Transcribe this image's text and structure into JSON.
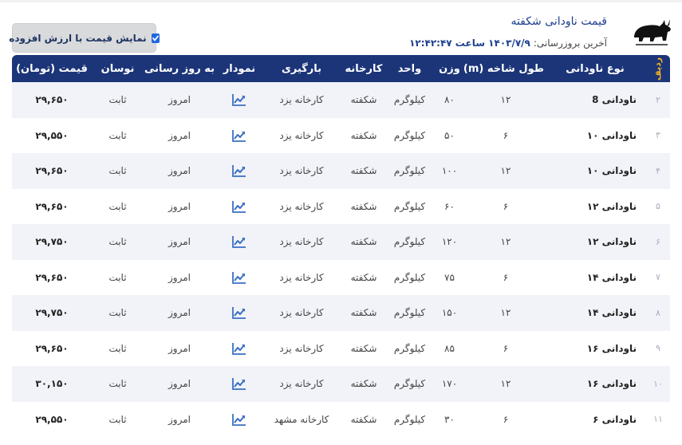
{
  "header": {
    "title": "قیمت ناودانی شکفته",
    "updated_label": "آخرین بروزرسانی:",
    "updated_value": "۱۴۰۳/۷/۹ ساعت ۱۲:۴۲:۴۷",
    "vat_label": "نمایش قیمت با ارزش افزوده",
    "vat_checked": true
  },
  "table": {
    "columns": {
      "idx": "ردیف",
      "type": "نوع ناودانی",
      "length": "طول شاخه (m)",
      "weight": "وزن",
      "unit": "واحد",
      "factory": "کارخانه",
      "loading": "بارگیری",
      "chart": "نمودار",
      "updated": "به روز رسانی",
      "fluct": "نوسان",
      "price": "قیمت (تومان)"
    },
    "rows": [
      {
        "idx": "۲",
        "type": "ناودانی 8",
        "length": "۱۲",
        "weight": "۸۰",
        "unit": "کیلوگرم",
        "factory": "شکفته",
        "loading": "کارخانه یزد",
        "updated": "امروز",
        "fluct": "ثابت",
        "price": "۲۹,۶۵۰"
      },
      {
        "idx": "۳",
        "type": "ناودانی ۱۰",
        "length": "۶",
        "weight": "۵۰",
        "unit": "کیلوگرم",
        "factory": "شکفته",
        "loading": "کارخانه یزد",
        "updated": "امروز",
        "fluct": "ثابت",
        "price": "۲۹,۵۵۰"
      },
      {
        "idx": "۴",
        "type": "ناودانی ۱۰",
        "length": "۱۲",
        "weight": "۱۰۰",
        "unit": "کیلوگرم",
        "factory": "شکفته",
        "loading": "کارخانه یزد",
        "updated": "امروز",
        "fluct": "ثابت",
        "price": "۲۹,۶۵۰"
      },
      {
        "idx": "۵",
        "type": "ناودانی ۱۲",
        "length": "۶",
        "weight": "۶۰",
        "unit": "کیلوگرم",
        "factory": "شکفته",
        "loading": "کارخانه یزد",
        "updated": "امروز",
        "fluct": "ثابت",
        "price": "۲۹,۶۵۰"
      },
      {
        "idx": "۶",
        "type": "ناودانی ۱۲",
        "length": "۱۲",
        "weight": "۱۲۰",
        "unit": "کیلوگرم",
        "factory": "شکفته",
        "loading": "کارخانه یزد",
        "updated": "امروز",
        "fluct": "ثابت",
        "price": "۲۹,۷۵۰"
      },
      {
        "idx": "۷",
        "type": "ناودانی ۱۴",
        "length": "۶",
        "weight": "۷۵",
        "unit": "کیلوگرم",
        "factory": "شکفته",
        "loading": "کارخانه یزد",
        "updated": "امروز",
        "fluct": "ثابت",
        "price": "۲۹,۶۵۰"
      },
      {
        "idx": "۸",
        "type": "ناودانی ۱۴",
        "length": "۱۲",
        "weight": "۱۵۰",
        "unit": "کیلوگرم",
        "factory": "شکفته",
        "loading": "کارخانه یزد",
        "updated": "امروز",
        "fluct": "ثابت",
        "price": "۲۹,۷۵۰"
      },
      {
        "idx": "۹",
        "type": "ناودانی ۱۶",
        "length": "۶",
        "weight": "۸۵",
        "unit": "کیلوگرم",
        "factory": "شکفته",
        "loading": "کارخانه یزد",
        "updated": "امروز",
        "fluct": "ثابت",
        "price": "۲۹,۶۵۰"
      },
      {
        "idx": "۱۰",
        "type": "ناودانی ۱۶",
        "length": "۱۲",
        "weight": "۱۷۰",
        "unit": "کیلوگرم",
        "factory": "شکفته",
        "loading": "کارخانه یزد",
        "updated": "امروز",
        "fluct": "ثابت",
        "price": "۳۰,۱۵۰"
      },
      {
        "idx": "۱۱",
        "type": "ناودانی ۶",
        "length": "۶",
        "weight": "۳۰",
        "unit": "کیلوگرم",
        "factory": "شکفته",
        "loading": "کارخانه مشهد",
        "updated": "امروز",
        "fluct": "ثابت",
        "price": "۲۹,۵۵۰"
      }
    ]
  },
  "colors": {
    "header_bg": "#1c3579",
    "accent": "#1d3f8f",
    "chart_icon": "#3a6fc4",
    "row_alt": "#f1f3f8"
  },
  "icons": {
    "chart": "chart-line-icon",
    "logo": "rhino-logo-icon",
    "checkbox": "checkbox-checked-icon"
  }
}
